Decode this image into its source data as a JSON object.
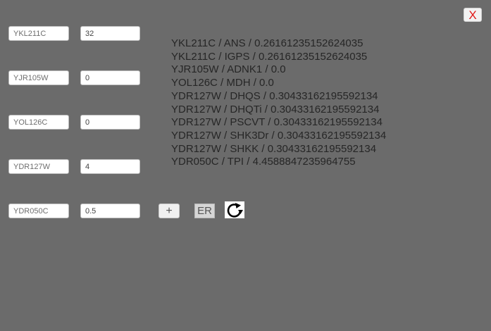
{
  "close_button": {
    "label": "X"
  },
  "gene_inputs": [
    {
      "gene": "YKL211C",
      "value": "32"
    },
    {
      "gene": "YJR105W",
      "value": "0"
    },
    {
      "gene": "YOL126C",
      "value": "0"
    },
    {
      "gene": "YDR127W",
      "value": "4"
    },
    {
      "gene": "YDR050C",
      "value": "0.5"
    }
  ],
  "results": [
    "YKL211C / ANS / 0.26161235152624035",
    "YKL211C / IGPS / 0.26161235152624035",
    "YJR105W / ADNK1 / 0.0",
    "YOL126C / MDH / 0.0",
    "YDR127W / DHQS / 0.30433162195592134",
    "YDR127W / DHQTi / 0.30433162195592134",
    "YDR127W / PSCVT / 0.30433162195592134",
    "YDR127W / SHK3Dr / 0.30433162195592134",
    "YDR127W / SHKK / 0.30433162195592134",
    "YDR050C / TPI / 4.4588847235964755"
  ],
  "toolbar": {
    "add_label": "+",
    "er_label": "ER",
    "refresh_icon": "refresh-icon"
  },
  "colors": {
    "background": "#6b6b6b",
    "close_text": "#e01818",
    "result_text": "#262626"
  }
}
